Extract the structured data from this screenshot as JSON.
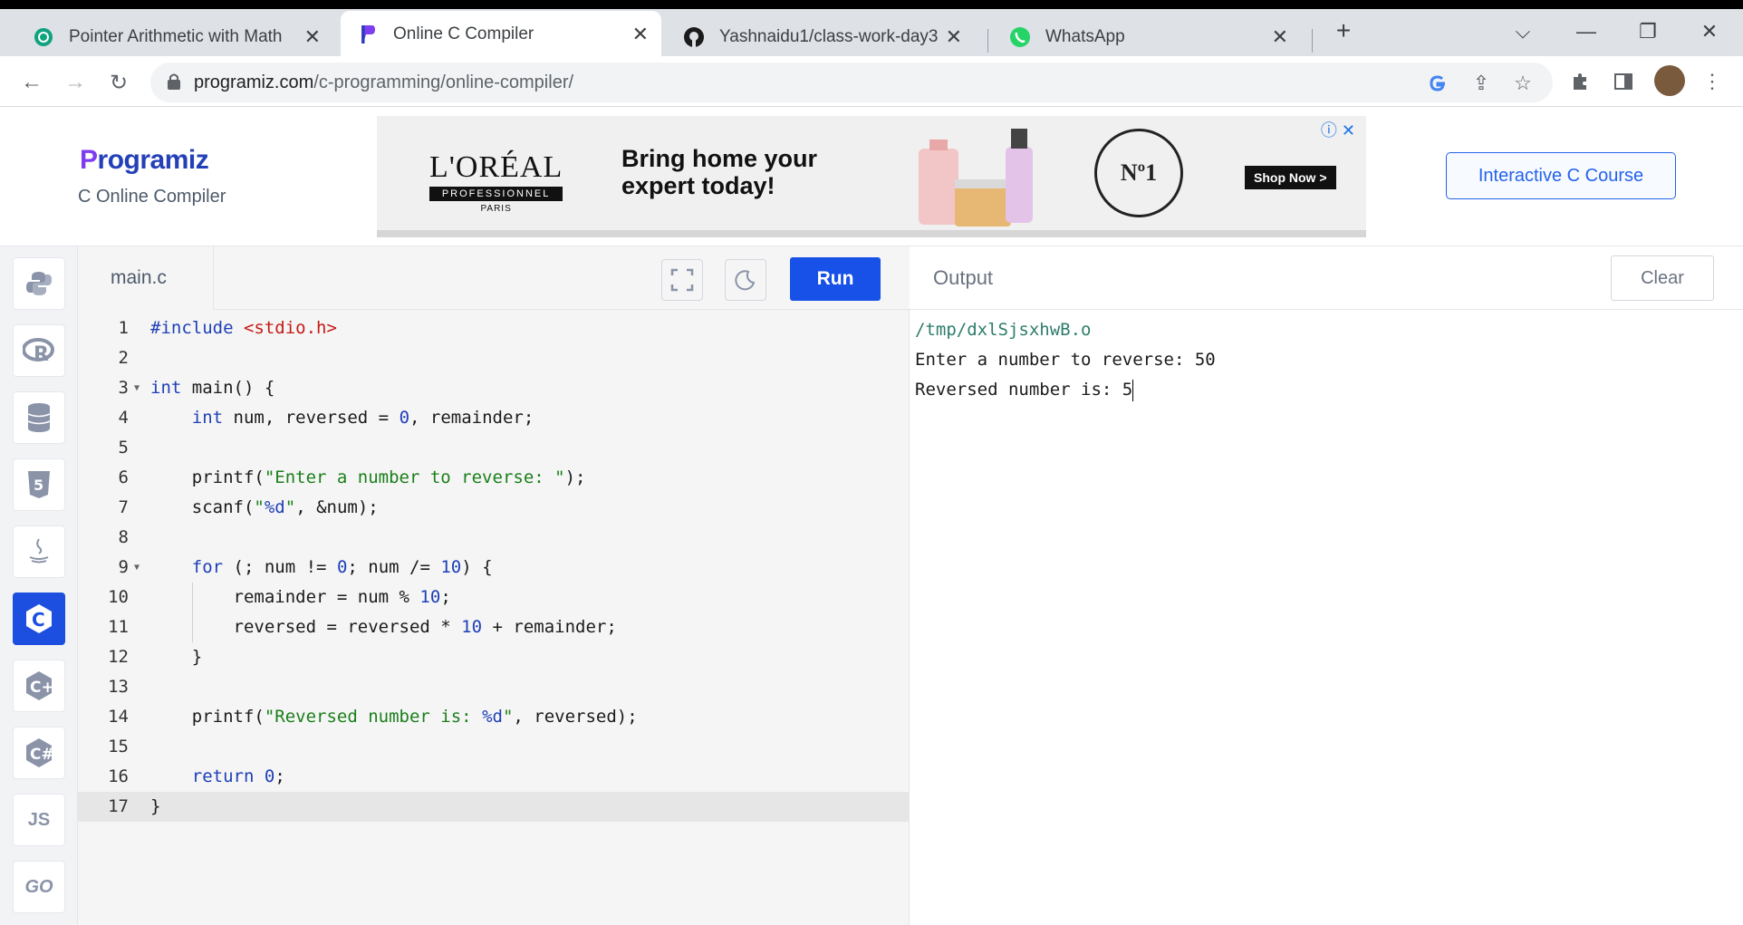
{
  "browser": {
    "tabs": [
      {
        "title": "Pointer Arithmetic with Math",
        "icon": "chatgpt-icon"
      },
      {
        "title": "Online C Compiler",
        "icon": "programiz-icon"
      },
      {
        "title": "Yashnaidu1/class-work-day3",
        "icon": "github-icon"
      },
      {
        "title": "WhatsApp",
        "icon": "whatsapp-icon"
      }
    ],
    "url_host": "programiz.com",
    "url_path": "/c-programming/online-compiler/"
  },
  "header": {
    "logo_text": "rogramiz",
    "logo_initial": "P",
    "subtitle": "C Online Compiler",
    "course_button": "Interactive C Course"
  },
  "ad": {
    "brand": "L'ORÉAL",
    "brand_line2": "PROFESSIONNEL",
    "brand_line3": "PARIS",
    "headline": "Bring home your expert today!",
    "seal": "Nº1",
    "cta": "Shop Now >"
  },
  "sidebar": {
    "items": [
      "python-icon",
      "r-icon",
      "sql-icon",
      "html5-icon",
      "java-icon",
      "c-icon",
      "cpp-icon",
      "csharp-icon",
      "js-icon",
      "go-icon"
    ],
    "js_label": "JS",
    "go_label": "GO"
  },
  "editor": {
    "file_name": "main.c",
    "run_label": "Run",
    "lines": [
      "#include <stdio.h>",
      "",
      "int main() {",
      "    int num, reversed = 0, remainder;",
      "",
      "    printf(\"Enter a number to reverse: \");",
      "    scanf(\"%d\", &num);",
      "",
      "    for (; num != 0; num /= 10) {",
      "        remainder = num % 10;",
      "        reversed = reversed * 10 + remainder;",
      "    }",
      "",
      "    printf(\"Reversed number is: %d\", reversed);",
      "",
      "    return 0;",
      "}"
    ]
  },
  "output": {
    "title": "Output",
    "clear_label": "Clear",
    "lines": [
      "/tmp/dxlSjsxhwB.o",
      "Enter a number to reverse: 50",
      "Reversed number is: 5"
    ]
  }
}
